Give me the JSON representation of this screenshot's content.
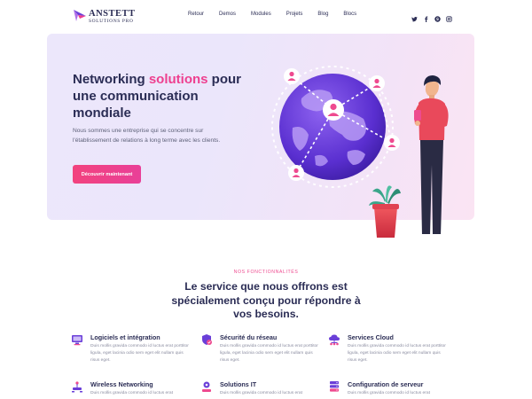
{
  "brand": {
    "name": "ANSTETT",
    "tagline": "SOLUTIONS PRO"
  },
  "nav": {
    "items": [
      {
        "label": "Retour"
      },
      {
        "label": "Demos"
      },
      {
        "label": "Modules"
      },
      {
        "label": "Projets"
      },
      {
        "label": "Blog"
      },
      {
        "label": "Blocs"
      }
    ]
  },
  "social": [
    "twitter-icon",
    "facebook-icon",
    "pinterest-icon",
    "instagram-icon"
  ],
  "hero": {
    "title_pre": "Networking ",
    "title_accent": "solutions",
    "title_post": " pour une communication mondiale",
    "description": "Nous sommes une entreprise qui se concentre sur l'établissement de relations à long terme avec les clients.",
    "cta": "Découvrir maintenant"
  },
  "features_section": {
    "kicker": "NOS FONCTIONNALITÉS",
    "title": "Le service que nous offrons est spécialement conçu pour répondre à vos besoins.",
    "items": [
      {
        "title": "Logiciels et intégration",
        "icon": "software-icon",
        "desc": "Duis mollis gravida commodo id luctus erat porttitor ligula, eget lacinia odio sem eget elit nullam quis risus eget."
      },
      {
        "title": "Sécurité du réseau",
        "icon": "shield-icon",
        "desc": "Duis mollis gravida commodo id luctus erat porttitor ligula, eget lacinia odio sem eget elit nullam quis risus eget."
      },
      {
        "title": "Services Cloud",
        "icon": "cloud-icon",
        "desc": "Duis mollis gravida commodo id luctus erat porttitor ligula, eget lacinia odio sem eget elit nullam quis risus eget."
      },
      {
        "title": "Wireless Networking",
        "icon": "wireless-icon",
        "desc": "Duis mollis gravida commodo id luctus erat"
      },
      {
        "title": "Solutions IT",
        "icon": "gear-icon",
        "desc": "Duis mollis gravida commodo id luctus erat"
      },
      {
        "title": "Configuration de serveur",
        "icon": "server-icon",
        "desc": "Duis mollis gravida commodo id luctus erat"
      }
    ]
  },
  "colors": {
    "accent": "#ee3f8f",
    "primary": "#2b2d55",
    "purple": "#6a3fd8"
  }
}
